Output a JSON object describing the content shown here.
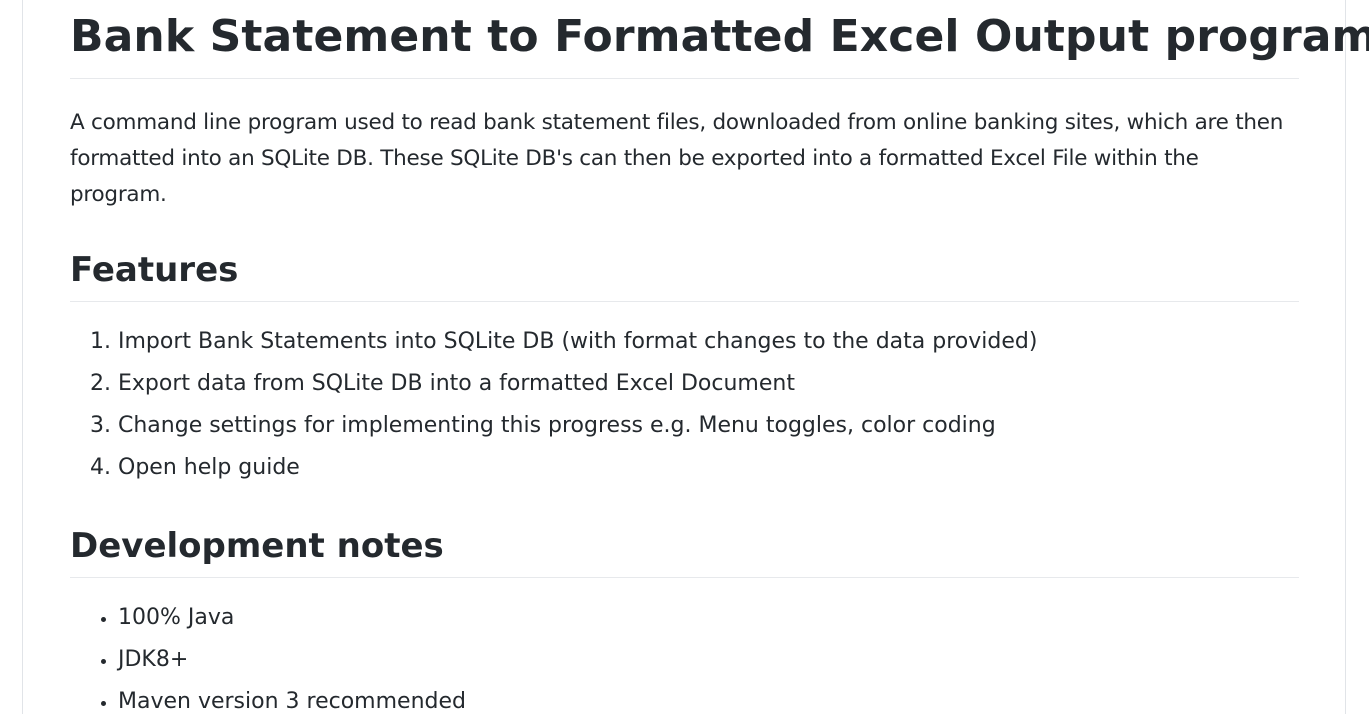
{
  "readme": {
    "title": "Bank Statement to Formatted Excel Output program",
    "intro": "A command line program used to read bank statement files, downloaded from online banking sites, which are then formatted into an SQLite DB. These SQLite DB's can then be exported into a formatted Excel File within the program.",
    "features": {
      "heading": "Features",
      "items": [
        "Import Bank Statements into SQLite DB (with format changes to the data provided)",
        "Export data from SQLite DB into a formatted Excel Document",
        "Change settings for implementing this progress e.g. Menu toggles, color coding",
        "Open help guide"
      ]
    },
    "development_notes": {
      "heading": "Development notes",
      "items": [
        "100% Java",
        "JDK8+",
        "Maven version 3 recommended"
      ]
    }
  }
}
